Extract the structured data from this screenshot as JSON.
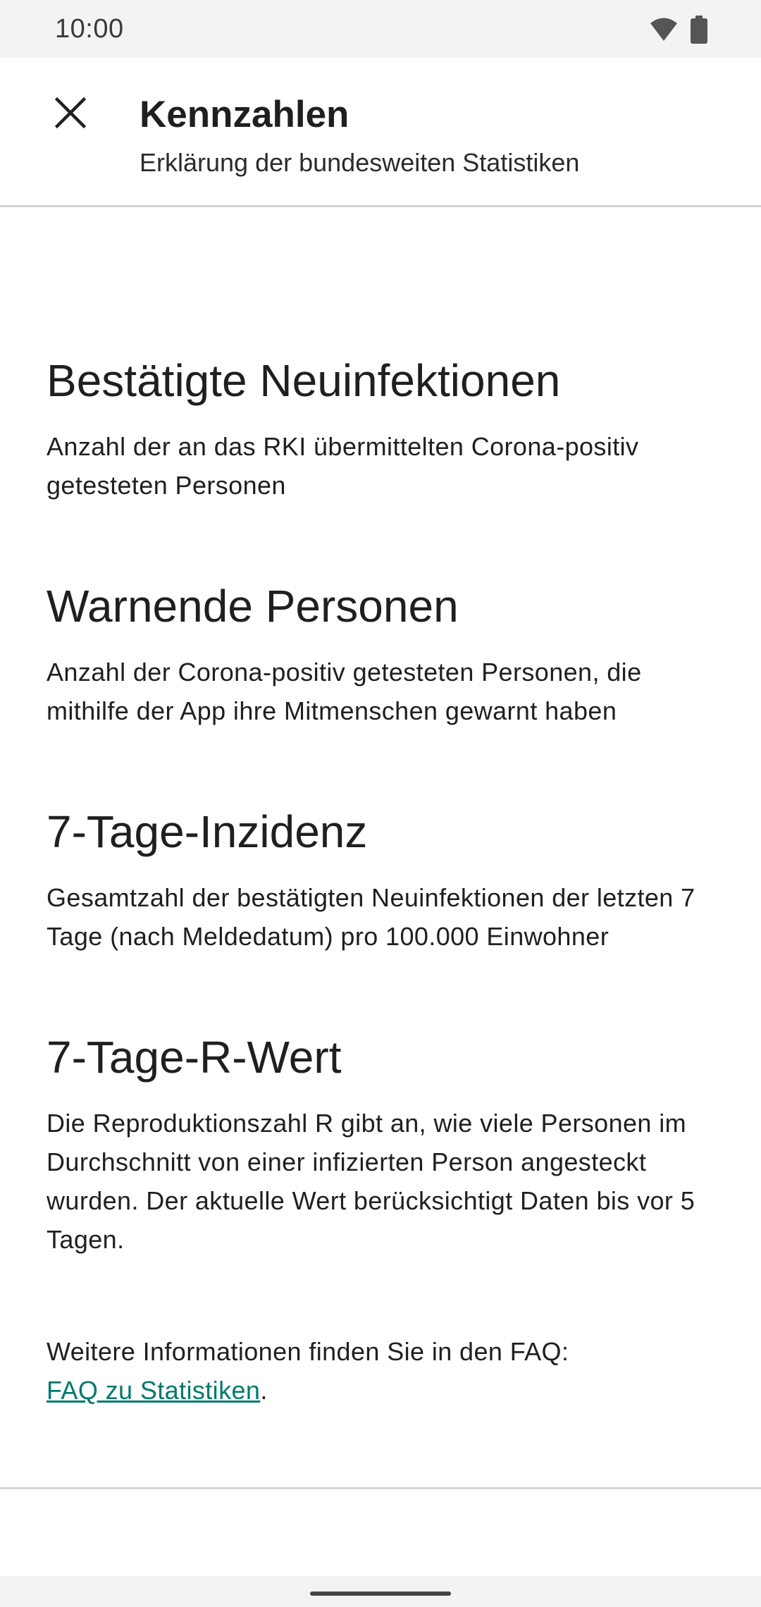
{
  "status_bar": {
    "time": "10:00",
    "icons": [
      "wifi-icon",
      "battery-icon"
    ]
  },
  "app_bar": {
    "close_icon": "close-icon",
    "title": "Kennzahlen",
    "subtitle": "Erklärung der bundesweiten Statistiken"
  },
  "sections": [
    {
      "title": "Bestätigte Neuinfektionen",
      "text": "Anzahl der an das RKI übermittelten Corona-positiv getesteten Personen"
    },
    {
      "title": "Warnende Personen",
      "text": "Anzahl der Corona-positiv getesteten Personen, die mithilfe der App ihre Mitmenschen gewarnt haben"
    },
    {
      "title": "7-Tage-Inzidenz",
      "text": "Gesamtzahl der bestätigten Neuinfektionen der letzten 7 Tage (nach Meldedatum) pro 100.000 Einwohner"
    },
    {
      "title": "7-Tage-R-Wert",
      "text": "Die Reproduktionszahl R gibt an, wie viele Personen im Durchschnitt von einer infizierten Person angesteckt wurden. Der aktuelle Wert berücksichtigt Daten bis vor 5 Tagen."
    }
  ],
  "more_info": {
    "text": "Weitere Informationen finden Sie in den FAQ:",
    "link_label": "FAQ zu Statistiken",
    "suffix": "."
  },
  "colors": {
    "link": "#00796b",
    "status_bar_bg": "#f3f3f3",
    "divider": "#d4d4d4"
  }
}
